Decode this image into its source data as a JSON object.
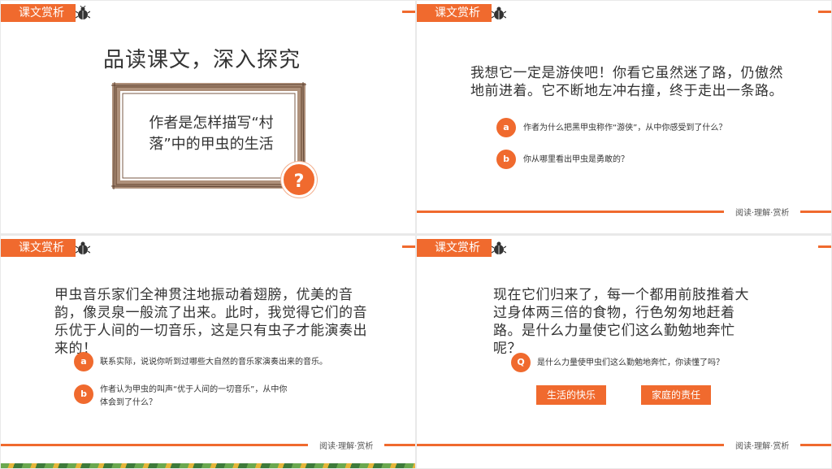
{
  "header": {
    "tag_label": "课文赏析"
  },
  "footer": {
    "label": "阅读·理解·赏析"
  },
  "slide1": {
    "title": "品读课文，深入探究",
    "frame_text": "作者是怎样描写“村落”中的甲虫的生活",
    "question_mark": "?"
  },
  "slide2": {
    "main": "我想它一定是游侠吧！你看它虽然迷了路，仍傲然地前进着。它不断地左冲右撞，终于走出一条路。",
    "questions": [
      {
        "marker": "a",
        "text": "作者为什么把黑甲虫称作“游侠”，从中你感受到了什么？"
      },
      {
        "marker": "b",
        "text": "你从哪里看出甲虫是勇敢的？"
      }
    ]
  },
  "slide3": {
    "main": "甲虫音乐家们全神贯注地振动着翅膀，优美的音韵，像灵泉一般流了出来。此时，我觉得它们的音乐优于人间的一切音乐，这是只有虫子才能演奏出来的！",
    "questions": [
      {
        "marker": "a",
        "text": "联系实际，说说你听到过哪些大自然的音乐家演奏出来的音乐。"
      },
      {
        "marker": "b",
        "text": "作者认为甲虫的叫声“优于人间的一切音乐”，从中你体会到了什么？"
      }
    ]
  },
  "slide4": {
    "main": "现在它们归来了，每一个都用前肢推着大过身体两三倍的食物，行色匆匆地赶着路。是什么力量使它们这么勤勉地奔忙呢？",
    "question": {
      "marker": "Q",
      "text": "是什么力量使甲虫们这么勤勉地奔忙，你读懂了吗？"
    },
    "buttons": [
      "生活的快乐",
      "家庭的责任"
    ]
  }
}
